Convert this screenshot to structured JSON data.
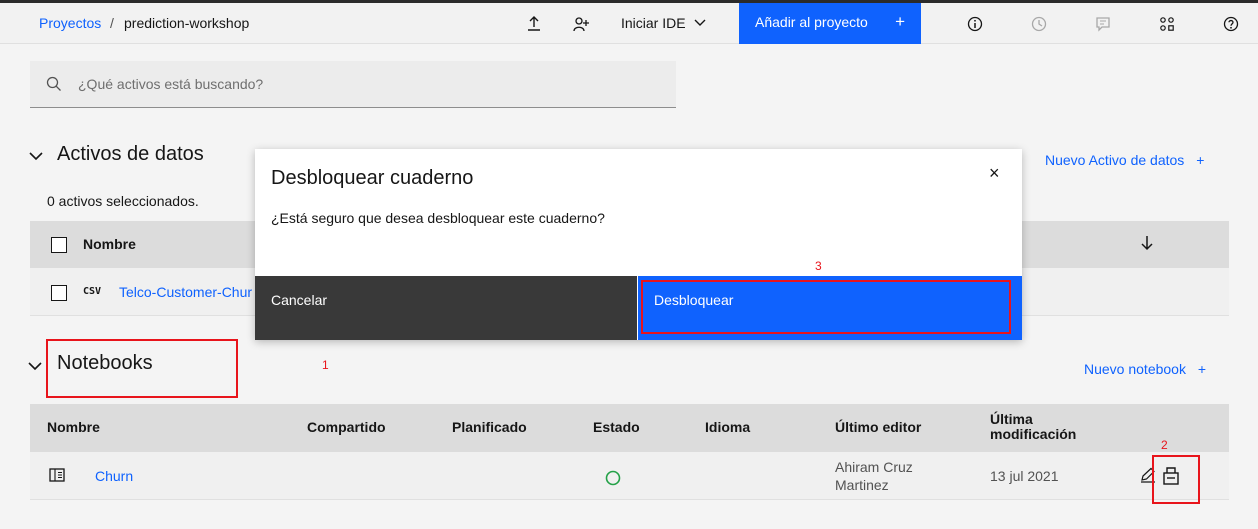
{
  "header": {
    "breadcrumb_link": "Proyectos",
    "breadcrumb_sep": "/",
    "breadcrumb_current": "prediction-workshop",
    "launch_ide": "Iniciar IDE",
    "add_to_project": "Añadir al proyecto",
    "add_plus": "+"
  },
  "search": {
    "placeholder": "¿Qué activos está buscando?"
  },
  "data_assets": {
    "title": "Activos de datos",
    "new_link": "Nuevo Activo de datos",
    "plus": "+",
    "selected": "0 activos seleccionados.",
    "col_name": "Nombre",
    "rows": [
      {
        "badge": "CSV",
        "name": "Telco-Customer-Chur"
      }
    ]
  },
  "notebooks": {
    "title": "Notebooks",
    "new_link": "Nuevo notebook",
    "plus": "+",
    "columns": [
      "Nombre",
      "Compartido",
      "Planificado",
      "Estado",
      "Idioma",
      "Último editor",
      "Última",
      "modificación"
    ],
    "rows": [
      {
        "name": "Churn",
        "editor_line1": "Ahiram Cruz",
        "editor_line2": "Martinez",
        "modified": "13 jul 2021"
      }
    ]
  },
  "modal": {
    "title": "Desbloquear cuaderno",
    "body": "¿Está seguro que desea desbloquear este cuaderno?",
    "close": "×",
    "cancel": "Cancelar",
    "confirm": "Desbloquear"
  },
  "annotations": {
    "n1": "1",
    "n2": "2",
    "n3": "3"
  },
  "colors": {
    "primary": "#0f62fe",
    "annotation": "#e8141b",
    "status_ok": "#24a148"
  }
}
